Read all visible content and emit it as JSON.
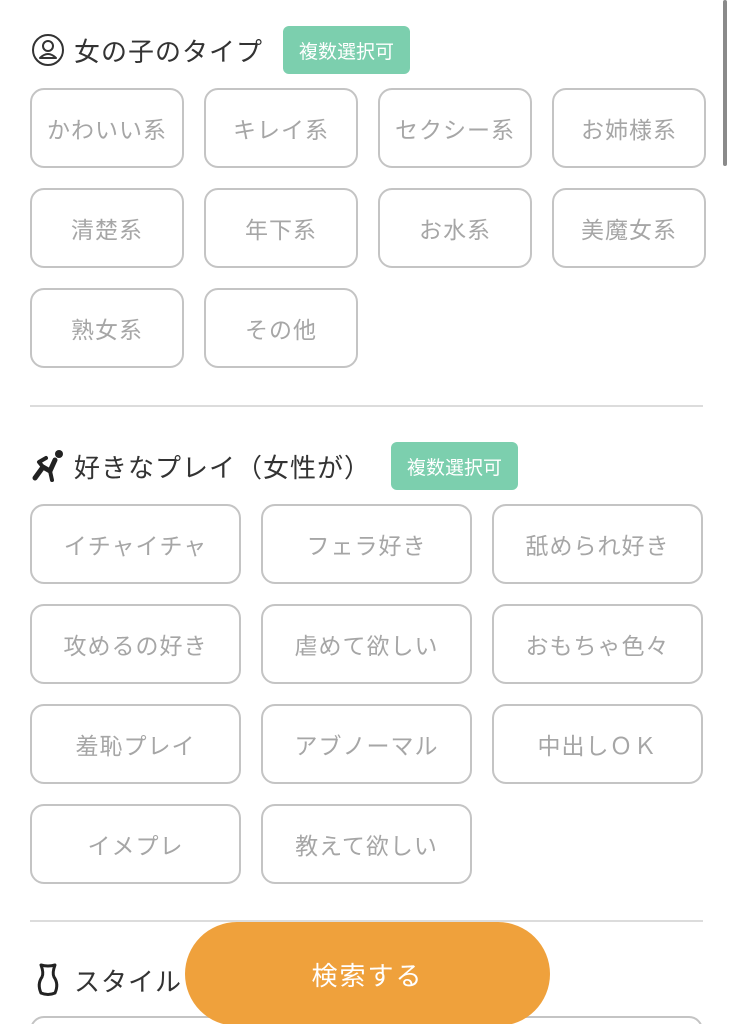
{
  "type_section": {
    "icon": "person-circle-icon",
    "title": "女の子のタイプ",
    "badge": "複数選択可",
    "options": [
      "かわいい系",
      "キレイ系",
      "セクシー系",
      "お姉様系",
      "清楚系",
      "年下系",
      "お水系",
      "美魔女系",
      "熟女系",
      "その他"
    ]
  },
  "play_section": {
    "icon": "running-figure-icon",
    "title": "好きなプレイ（女性が）",
    "badge": "複数選択可",
    "options": [
      "イチャイチャ",
      "フェラ好き",
      "舐められ好き",
      "攻めるの好き",
      "虐めて欲しい",
      "おもちゃ色々",
      "羞恥プレイ",
      "アブノーマル",
      "中出しＯＫ",
      "イメプレ",
      "教えて欲しい"
    ]
  },
  "style_section": {
    "icon": "body-shape-icon",
    "title": "スタイル"
  },
  "search_button": {
    "label": "検索する"
  },
  "colors": {
    "accent_green": "#7ccfae",
    "search_orange": "#efa13c",
    "chip_border": "#c4c4c4",
    "chip_text": "#a6a6a6"
  }
}
